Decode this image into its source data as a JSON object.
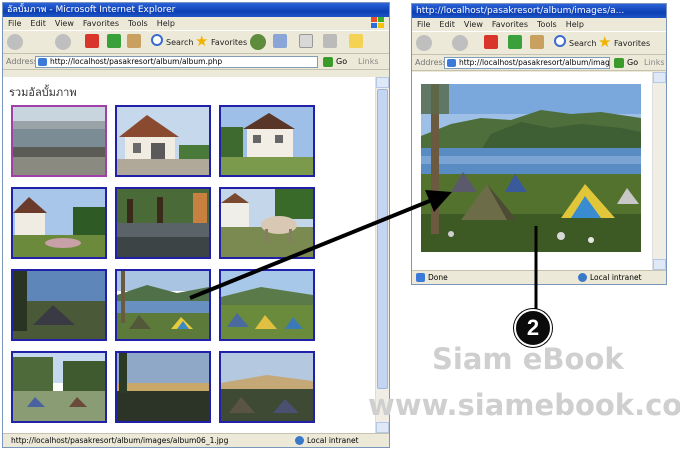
{
  "main_window": {
    "title": "อัลบั้มภาพ - Microsoft Internet Explorer",
    "menu": [
      "File",
      "Edit",
      "View",
      "Favorites",
      "Tools",
      "Help"
    ],
    "toolbar": {
      "search_label": "Search",
      "favorites_label": "Favorites"
    },
    "address_label": "Address",
    "address_url": "http://localhost/pasakresort/album/album.php",
    "go_label": "Go",
    "links_label": "Links",
    "page_heading": "รวมอัลบั้มภาพ",
    "status_url": "http://localhost/pasakresort/album/images/album06_1.jpg",
    "status_zone": "Local intranet",
    "thumbnails": [
      {
        "scene": "lake"
      },
      {
        "scene": "house-garage"
      },
      {
        "scene": "house-lawn"
      },
      {
        "scene": "house-garden"
      },
      {
        "scene": "trees-road"
      },
      {
        "scene": "cow-field"
      },
      {
        "scene": "tent-evening"
      },
      {
        "scene": "tents-lake"
      },
      {
        "scene": "tents-blue"
      },
      {
        "scene": "campers-trees"
      },
      {
        "scene": "lake-sunset"
      },
      {
        "scene": "tents-dusk"
      }
    ]
  },
  "popup_window": {
    "title": "http://localhost/pasakresort/album/images/a...",
    "menu": [
      "File",
      "Edit",
      "View",
      "Favorites",
      "Tools",
      "Help"
    ],
    "toolbar": {
      "search_label": "Search",
      "favorites_label": "Favorites"
    },
    "address_label": "Address",
    "address_url": "http://localhost/pasakresort/album/images/a",
    "go_label": "Go",
    "links_label": "Links",
    "status_left": "Done",
    "status_zone": "Local intranet"
  },
  "callout_number": "2",
  "watermark": {
    "line1": "Siam eBook",
    "line2": "www.siamebook.com"
  },
  "colors": {
    "xp_title": "#0c3fb4",
    "thumb_border": "#2020a8",
    "chrome": "#ece9d8"
  }
}
